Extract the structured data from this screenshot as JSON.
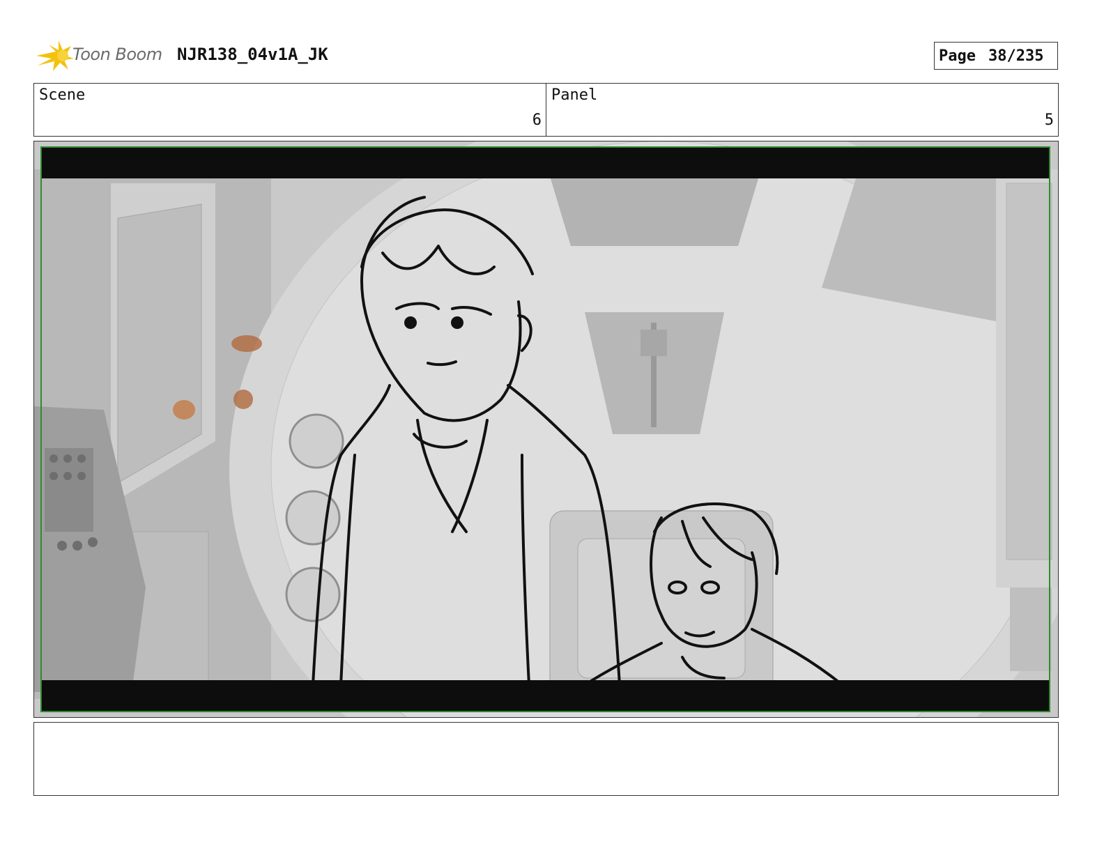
{
  "header": {
    "brand_name": "Toon Boom",
    "doc_title": "NJR138_04v1A_JK",
    "page_label": "Page",
    "page_number": "38/235"
  },
  "scene": {
    "label": "Scene",
    "value": "6"
  },
  "panel": {
    "label": "Panel",
    "value": "5"
  },
  "frame": {
    "description_icon": "storyboard-sketch-image",
    "letterbox_color": "#0d0d0d",
    "safe_area_color": "#2e8b2e"
  },
  "notes": {
    "text": ""
  }
}
